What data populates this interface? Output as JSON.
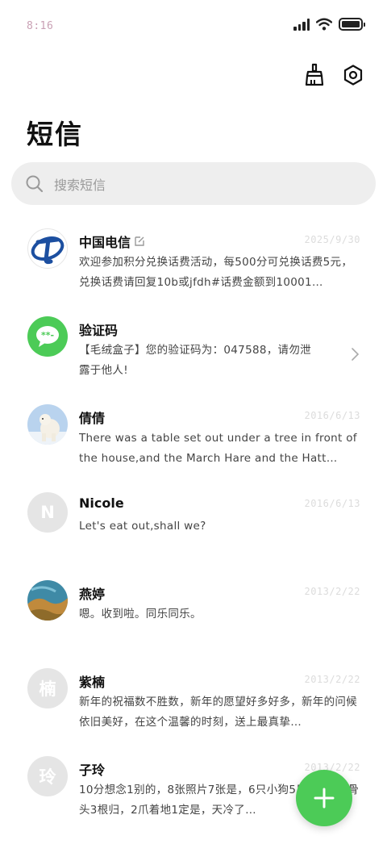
{
  "status_bar": {
    "time": "8:16"
  },
  "header": {
    "title": "短信"
  },
  "search": {
    "placeholder": "搜索短信"
  },
  "conversations": [
    {
      "name": "中国电信",
      "date": "2025/9/30",
      "preview": "欢迎参加积分兑换话费活动，每500分可兑换话费5元，兑换话费请回复10b或jfdh#话费金额到10001…"
    },
    {
      "name": "验证码",
      "date": "",
      "preview": "【毛绒盒子】您的验证码为：047588，请勿泄露于他人!"
    },
    {
      "name": "倩倩",
      "date": "2016/6/13",
      "preview": "There was a table set out under a tree in front of the house,and the March Hare and the Hatt…"
    },
    {
      "name": "Nicole",
      "avatar_letter": "N",
      "date": "2016/6/13",
      "preview": "Let's eat out,shall we?"
    },
    {
      "name": "燕婷",
      "date": "2013/2/22",
      "preview": "嗯。收到啦。同乐同乐。"
    },
    {
      "name": "紫楠",
      "avatar_letter": "楠",
      "date": "2013/2/22",
      "preview": "新年的祝福数不胜数，新年的愿望好多好多，新年的问候依旧美好，在这个温馨的时刻，送上最真挚…"
    },
    {
      "name": "子玲",
      "avatar_letter": "玲",
      "date": "2013/2/22",
      "preview": "10分想念1别的，8张照片7张是，6只小狗5只像，4根骨头3根归，2爪着地1定是，天冷了…"
    }
  ],
  "colors": {
    "accent_green": "#4ccb57",
    "telecom_blue": "#1c4fa0",
    "wechat_green": "#4ccb57"
  },
  "icons": {
    "clean": "broom-icon",
    "settings": "settings-icon",
    "search": "search-icon",
    "fab": "plus-icon"
  }
}
